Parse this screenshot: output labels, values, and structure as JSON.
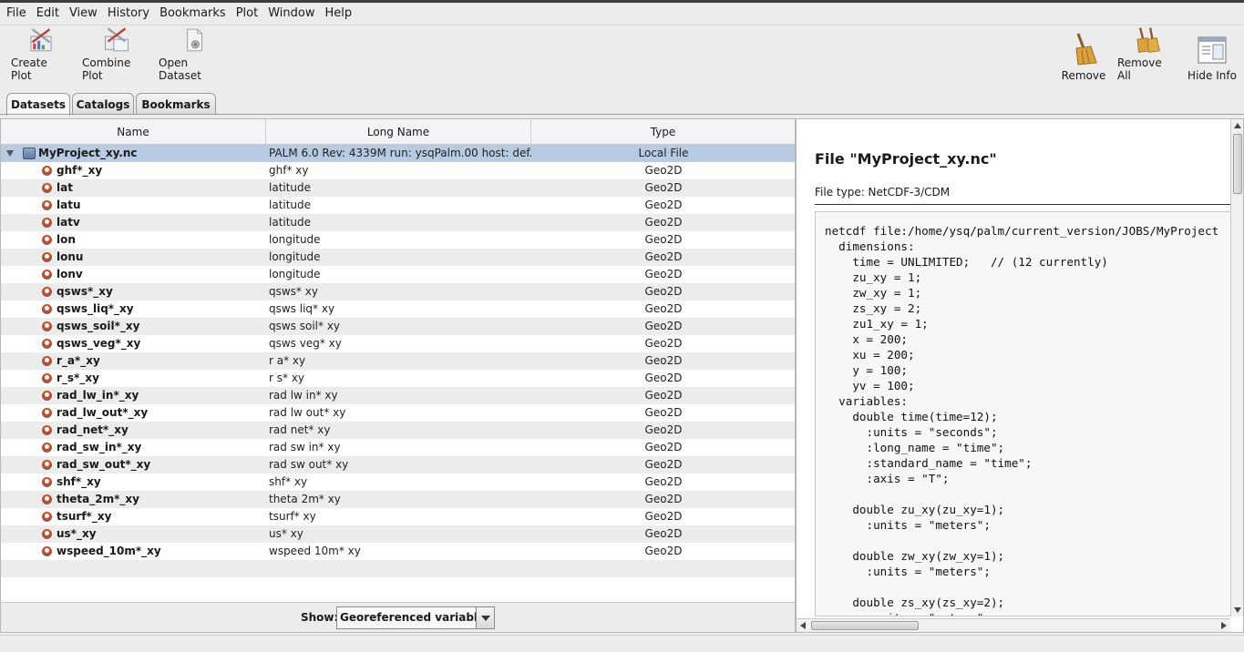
{
  "menubar": {
    "items": [
      "File",
      "Edit",
      "View",
      "History",
      "Bookmarks",
      "Plot",
      "Window",
      "Help"
    ]
  },
  "toolbar": {
    "create_plot": "Create Plot",
    "combine_plot": "Combine Plot",
    "open_dataset": "Open Dataset",
    "remove": "Remove",
    "remove_all": "Remove All",
    "hide_info": "Hide Info"
  },
  "tabs": [
    "Datasets",
    "Catalogs",
    "Bookmarks"
  ],
  "table": {
    "columns": [
      "Name",
      "Long Name",
      "Type"
    ],
    "file_row": {
      "name": "MyProject_xy.nc",
      "long_name": "PALM 6.0  Rev: 4339M  run: ysqPalm.00  host: def...",
      "type": "Local File"
    },
    "rows": [
      {
        "name": "ghf*_xy",
        "long_name": "ghf* xy",
        "type": "Geo2D"
      },
      {
        "name": "lat",
        "long_name": "latitude",
        "type": "Geo2D"
      },
      {
        "name": "latu",
        "long_name": "latitude",
        "type": "Geo2D"
      },
      {
        "name": "latv",
        "long_name": "latitude",
        "type": "Geo2D"
      },
      {
        "name": "lon",
        "long_name": "longitude",
        "type": "Geo2D"
      },
      {
        "name": "lonu",
        "long_name": "longitude",
        "type": "Geo2D"
      },
      {
        "name": "lonv",
        "long_name": "longitude",
        "type": "Geo2D"
      },
      {
        "name": "qsws*_xy",
        "long_name": "qsws* xy",
        "type": "Geo2D"
      },
      {
        "name": "qsws_liq*_xy",
        "long_name": "qsws liq* xy",
        "type": "Geo2D"
      },
      {
        "name": "qsws_soil*_xy",
        "long_name": "qsws soil* xy",
        "type": "Geo2D"
      },
      {
        "name": "qsws_veg*_xy",
        "long_name": "qsws veg* xy",
        "type": "Geo2D"
      },
      {
        "name": "r_a*_xy",
        "long_name": "r a* xy",
        "type": "Geo2D"
      },
      {
        "name": "r_s*_xy",
        "long_name": "r s* xy",
        "type": "Geo2D"
      },
      {
        "name": "rad_lw_in*_xy",
        "long_name": "rad lw in* xy",
        "type": "Geo2D"
      },
      {
        "name": "rad_lw_out*_xy",
        "long_name": "rad lw out* xy",
        "type": "Geo2D"
      },
      {
        "name": "rad_net*_xy",
        "long_name": "rad net* xy",
        "type": "Geo2D"
      },
      {
        "name": "rad_sw_in*_xy",
        "long_name": "rad sw in* xy",
        "type": "Geo2D"
      },
      {
        "name": "rad_sw_out*_xy",
        "long_name": "rad sw out* xy",
        "type": "Geo2D"
      },
      {
        "name": "shf*_xy",
        "long_name": "shf* xy",
        "type": "Geo2D"
      },
      {
        "name": "theta_2m*_xy",
        "long_name": "theta 2m* xy",
        "type": "Geo2D"
      },
      {
        "name": "tsurf*_xy",
        "long_name": "tsurf* xy",
        "type": "Geo2D"
      },
      {
        "name": "us*_xy",
        "long_name": "us* xy",
        "type": "Geo2D"
      },
      {
        "name": "wspeed_10m*_xy",
        "long_name": "wspeed 10m* xy",
        "type": "Geo2D"
      }
    ]
  },
  "show": {
    "label": "Show:",
    "selected": "Georeferenced variables"
  },
  "info": {
    "title": "File \"MyProject_xy.nc\"",
    "file_type": "File type: NetCDF-3/CDM",
    "lines": [
      "netcdf file:/home/ysq/palm/current_version/JOBS/MyProject",
      "  dimensions:",
      "    time = UNLIMITED;   // (12 currently)",
      "    zu_xy = 1;",
      "    zw_xy = 1;",
      "    zs_xy = 2;",
      "    zu1_xy = 1;",
      "    x = 200;",
      "    xu = 200;",
      "    y = 100;",
      "    yv = 100;",
      "  variables:",
      "    double time(time=12);",
      "      :units = \"seconds\";",
      "      :long_name = \"time\";",
      "      :standard_name = \"time\";",
      "      :axis = \"T\";",
      "",
      "    double zu_xy(zu_xy=1);",
      "      :units = \"meters\";",
      "",
      "    double zw_xy(zw_xy=1);",
      "      :units = \"meters\";",
      "",
      "    double zs_xy(zs_xy=2);",
      "      :units = \"meters\";"
    ]
  }
}
